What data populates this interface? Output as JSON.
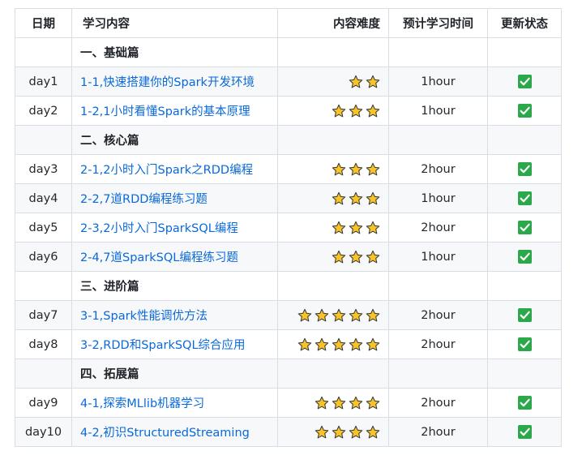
{
  "table": {
    "headers": {
      "date": "日期",
      "content": "学习内容",
      "difficulty": "内容难度",
      "time": "预计学习时间",
      "status": "更新状态"
    },
    "rows": [
      {
        "type": "section",
        "title": "一、基础篇"
      },
      {
        "type": "item",
        "date": "day1",
        "content": "1-1,快速搭建你的Spark开发环境",
        "stars": 2,
        "time": "1hour",
        "status": "done"
      },
      {
        "type": "item",
        "date": "day2",
        "content": "1-2,1小时看懂Spark的基本原理",
        "stars": 3,
        "time": "1hour",
        "status": "done"
      },
      {
        "type": "section",
        "title": "二、核心篇"
      },
      {
        "type": "item",
        "date": "day3",
        "content": "2-1,2小时入门Spark之RDD编程",
        "stars": 3,
        "time": "2hour",
        "status": "done"
      },
      {
        "type": "item",
        "date": "day4",
        "content": "2-2,7道RDD编程练习题",
        "stars": 3,
        "time": "1hour",
        "status": "done"
      },
      {
        "type": "item",
        "date": "day5",
        "content": "2-3,2小时入门SparkSQL编程",
        "stars": 3,
        "time": "2hour",
        "status": "done"
      },
      {
        "type": "item",
        "date": "day6",
        "content": "2-4,7道SparkSQL编程练习题",
        "stars": 3,
        "time": "1hour",
        "status": "done"
      },
      {
        "type": "section",
        "title": "三、进阶篇"
      },
      {
        "type": "item",
        "date": "day7",
        "content": "3-1,Spark性能调优方法",
        "stars": 5,
        "time": "2hour",
        "status": "done"
      },
      {
        "type": "item",
        "date": "day8",
        "content": "3-2,RDD和SparkSQL综合应用",
        "stars": 5,
        "time": "2hour",
        "status": "done"
      },
      {
        "type": "section",
        "title": "四、拓展篇"
      },
      {
        "type": "item",
        "date": "day9",
        "content": "4-1,探索MLlib机器学习",
        "stars": 4,
        "time": "2hour",
        "status": "done"
      },
      {
        "type": "item",
        "date": "day10",
        "content": "4-2,初识StructuredStreaming",
        "stars": 4,
        "time": "2hour",
        "status": "done"
      }
    ]
  },
  "icons": {
    "difficulty": "star-icon",
    "status_done": "check-box-icon"
  },
  "colors": {
    "link": "#0969da",
    "border": "#d8dee4",
    "stripe": "#f6f8fa",
    "star_fill": "#f7c325",
    "star_stroke": "#3b3b3b",
    "check_bg": "#2ba84a"
  }
}
